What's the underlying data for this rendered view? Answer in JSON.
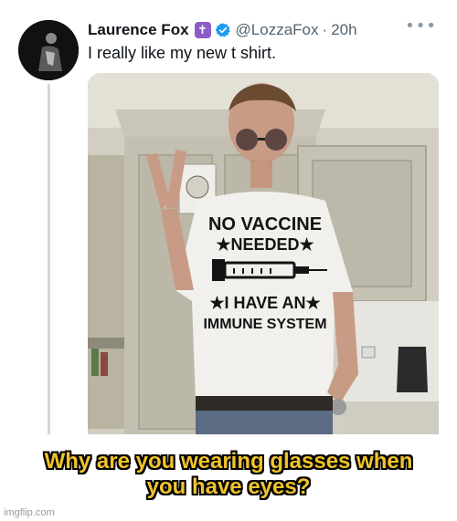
{
  "tweet": {
    "display_name": "Laurence Fox",
    "badge_icon": "cross-badge-icon",
    "verified_icon": "verified-badge-icon",
    "handle": "@LozzaFox",
    "separator": "·",
    "time": "20h",
    "more_icon": "more-icon",
    "text": "I really like my new t shirt.",
    "colors": {
      "verified": "#1d9bf0",
      "badge": "#8e5cc8",
      "secondary": "#536471"
    }
  },
  "photo": {
    "shirt_lines": [
      "NO VACCINE",
      "★NEEDED★",
      "★I HAVE AN★",
      "IMMUNE SYSTEM"
    ]
  },
  "meme": {
    "caption_line1": "Why are you wearing glasses when",
    "caption_line2": "you have eyes?",
    "watermark": "imgflip.com",
    "caption_color": "#f0c32a"
  }
}
